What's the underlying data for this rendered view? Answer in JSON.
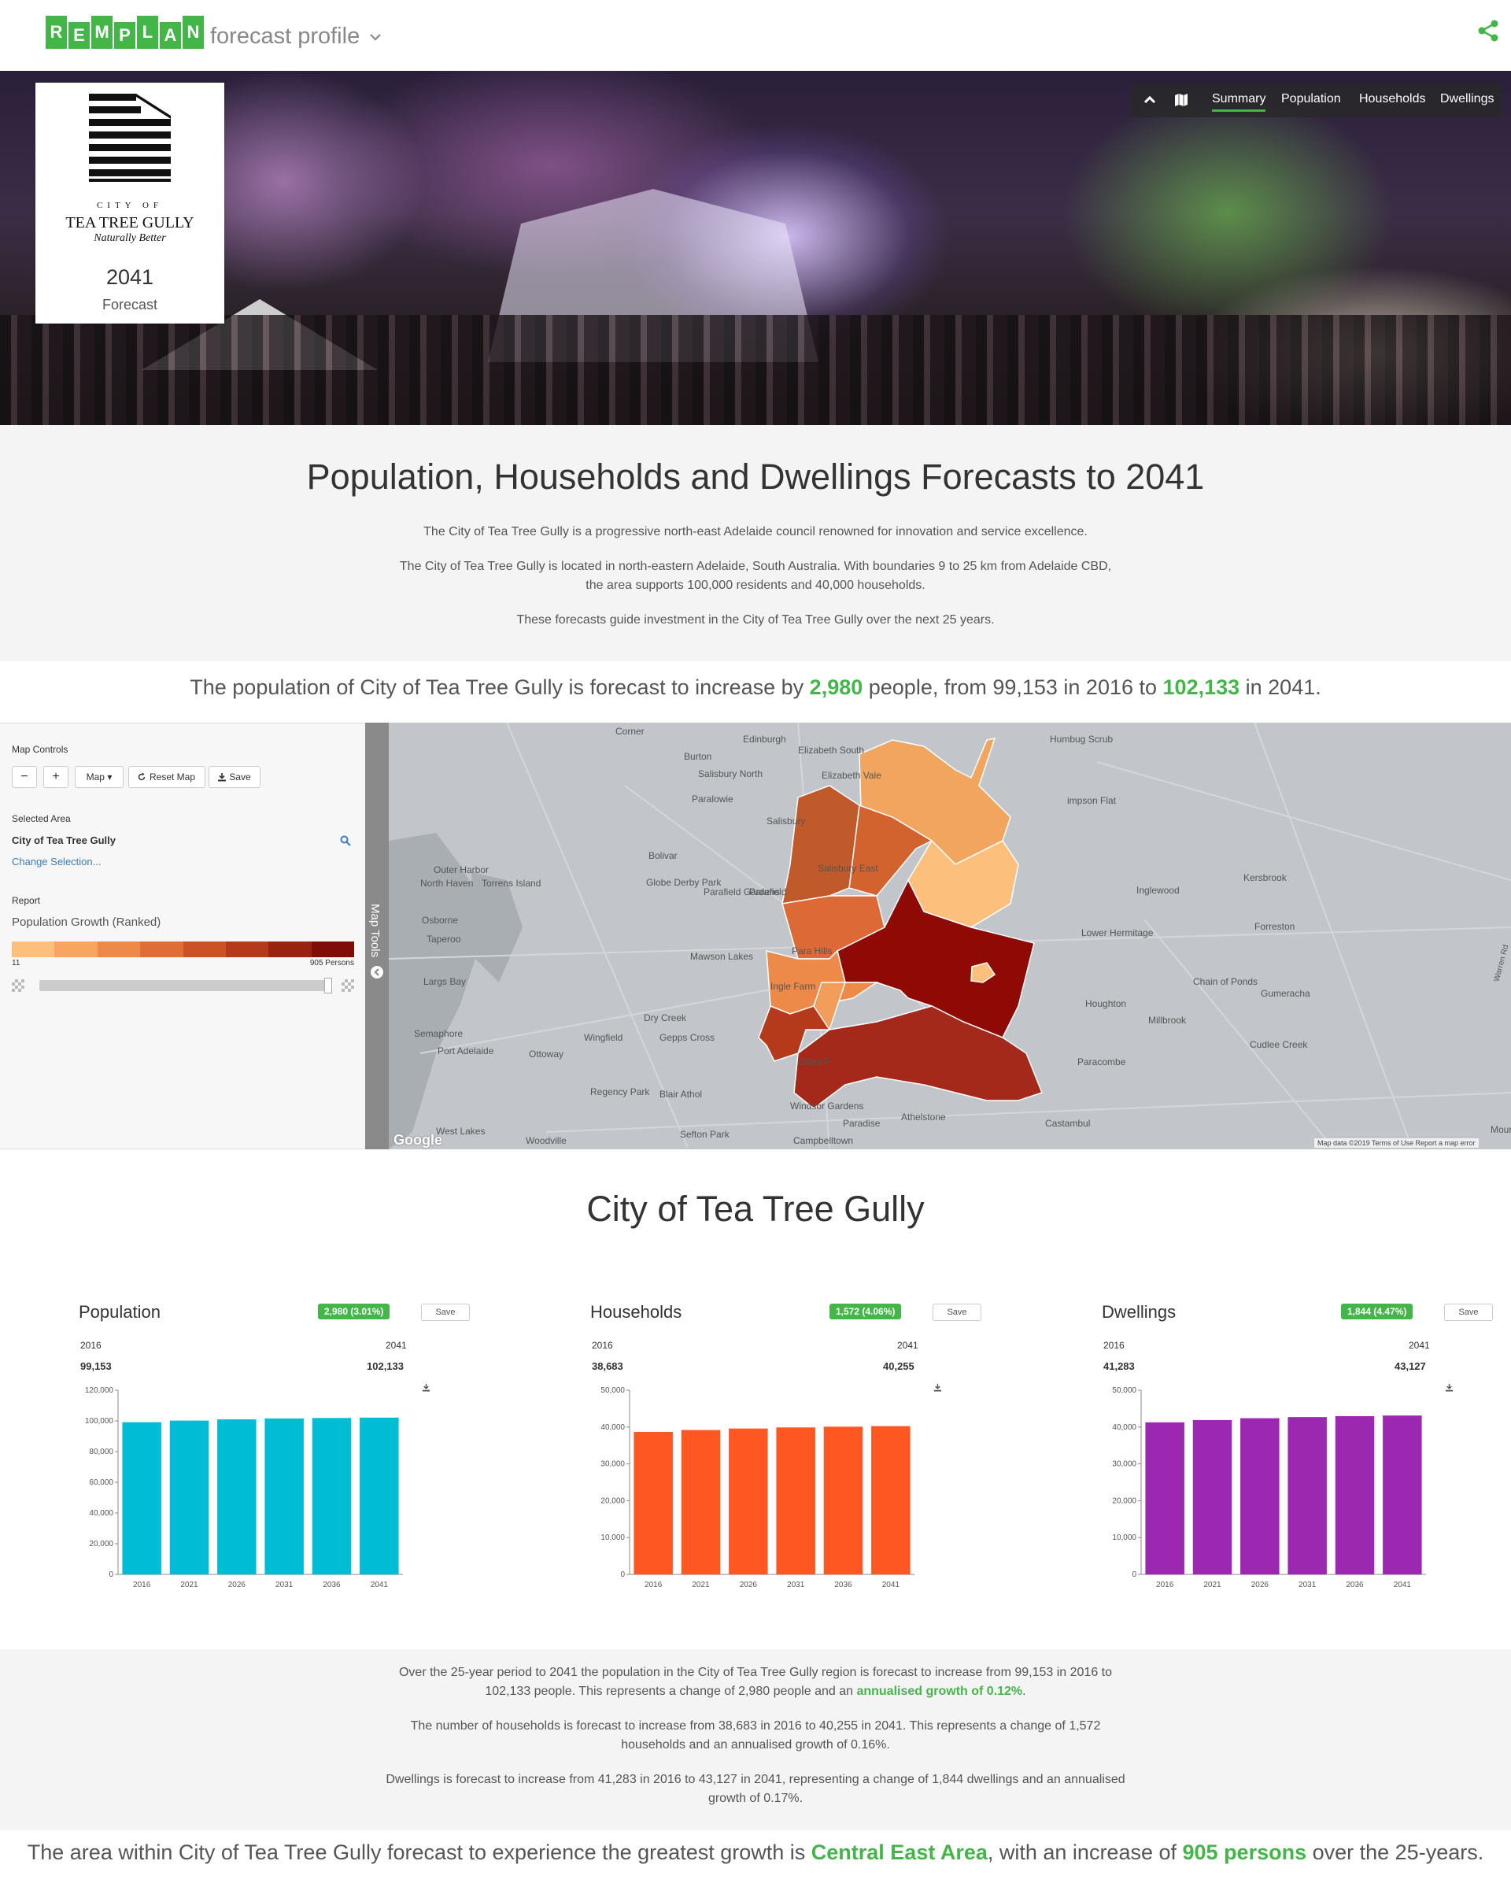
{
  "brand": {
    "logo_letters": [
      "R",
      "E",
      "M",
      "P",
      "L",
      "A",
      "N"
    ],
    "product": "forecast profile"
  },
  "council": {
    "city_of": "CITY OF",
    "name": "TEA TREE GULLY",
    "tagline": "Naturally Better",
    "year": "2041",
    "subtitle": "Forecast"
  },
  "nav": {
    "links": [
      "Summary",
      "Population",
      "Households",
      "Dwellings"
    ],
    "active": "Summary"
  },
  "intro": {
    "title": "Population, Households and Dwellings Forecasts to 2041",
    "p1": "The City of Tea Tree Gully is a progressive north-east Adelaide council renowned for innovation and service excellence.",
    "p2": "The City of Tea Tree Gully is located in north-eastern Adelaide, South Australia. With boundaries 9 to 25 km from Adelaide CBD, the area supports 100,000 residents and 40,000 households.",
    "p3": "These forecasts guide investment in the City of Tea Tree Gully over the next 25 years."
  },
  "headline": {
    "pre": "The population of City of Tea Tree Gully is forecast to increase by ",
    "change": "2,980",
    "mid": " people, from 99,153 in 2016 to ",
    "end_value": "102,133",
    "post": " in 2041."
  },
  "map_controls": {
    "title": "Map Controls",
    "zoom_out": "−",
    "zoom_in": "+",
    "map_button": "Map ▾",
    "reset_button": "Reset Map",
    "save_button": "Save",
    "selected_area_label": "Selected Area",
    "selected_area": "City of Tea Tree Gully",
    "change_selection": "Change Selection...",
    "report_label": "Report",
    "report_name": "Population Growth (Ranked)",
    "legend_min": "11",
    "legend_max": "905 Persons",
    "legend_colors": [
      "#fdbf7c",
      "#f7a560",
      "#ee8a49",
      "#e06c36",
      "#cc5226",
      "#b5391b",
      "#9a2210",
      "#7f0c06"
    ],
    "map_tools": "Map Tools"
  },
  "map": {
    "attribution": "Map data ©2019   Terms of Use   Report a map error",
    "google": "Google",
    "places": [
      "Corner",
      "Edinburgh",
      "Burton",
      "Elizabeth South",
      "Elizabeth Vale",
      "Salisbury North",
      "Paralowie",
      "Salisbury",
      "Humbug Scrub",
      "impson Flat",
      "Bolivar",
      "Salisbury East",
      "Outer Harbor",
      "North Haven",
      "Torrens Island",
      "Globe Derby Park",
      "Parafield Gardens",
      "Parafield",
      "Inglewood",
      "Kersbrook",
      "Osborne",
      "Taperoo",
      "Lower Hermitage",
      "Forreston",
      "Mawson Lakes",
      "Para Hills",
      "Largs Bay",
      "Ingle Farm",
      "Chain of Ponds",
      "Gumeracha",
      "Houghton",
      "Dry Creek",
      "Millbrook",
      "Semaphore",
      "Wingfield",
      "Gepps Cross",
      "Port Adelaide",
      "Ottoway",
      "Cudlee Creek",
      "Gilles P",
      "Paracombe",
      "Regency Park",
      "Blair Athol",
      "Windsor Gardens",
      "Paradise",
      "Athelstone",
      "Castambul",
      "West Lakes",
      "Woodville",
      "Sefton Park",
      "Campbelltown",
      "Mount",
      "Warren Rd"
    ]
  },
  "section_title": "City of Tea Tree Gully",
  "charts_meta": [
    {
      "title": "Population",
      "badge": "2,980 (3.01%)",
      "save": "Save",
      "start_year": "2016",
      "end_year": "2041",
      "start_value": "99,153",
      "end_value": "102,133"
    },
    {
      "title": "Households",
      "badge": "1,572 (4.06%)",
      "save": "Save",
      "start_year": "2016",
      "end_year": "2041",
      "start_value": "38,683",
      "end_value": "40,255"
    },
    {
      "title": "Dwellings",
      "badge": "1,844 (4.47%)",
      "save": "Save",
      "start_year": "2016",
      "end_year": "2041",
      "start_value": "41,283",
      "end_value": "43,127"
    }
  ],
  "chart_data": [
    {
      "type": "bar",
      "title": "Population",
      "categories": [
        "2016",
        "2021",
        "2026",
        "2031",
        "2036",
        "2041"
      ],
      "values": [
        99153,
        100200,
        101000,
        101600,
        101900,
        102133
      ],
      "ylim": [
        0,
        120000
      ],
      "yticks": [
        "0",
        "20,000",
        "40,000",
        "60,000",
        "80,000",
        "100,000",
        "120,000"
      ],
      "color": "#00bcd4"
    },
    {
      "type": "bar",
      "title": "Households",
      "categories": [
        "2016",
        "2021",
        "2026",
        "2031",
        "2036",
        "2041"
      ],
      "values": [
        38683,
        39200,
        39600,
        39900,
        40100,
        40255
      ],
      "ylim": [
        0,
        50000
      ],
      "yticks": [
        "0",
        "10,000",
        "20,000",
        "30,000",
        "40,000",
        "50,000"
      ],
      "color": "#ff5722"
    },
    {
      "type": "bar",
      "title": "Dwellings",
      "categories": [
        "2016",
        "2021",
        "2026",
        "2031",
        "2036",
        "2041"
      ],
      "values": [
        41283,
        41900,
        42400,
        42700,
        42950,
        43127
      ],
      "ylim": [
        0,
        50000
      ],
      "yticks": [
        "0",
        "10,000",
        "20,000",
        "30,000",
        "40,000",
        "50,000"
      ],
      "color": "#9c27b0"
    }
  ],
  "summary": {
    "p1_pre": "Over the 25-year period to 2041 the population in the City of Tea Tree Gully region is forecast to increase from 99,153 in 2016 to 102,133 people. This represents a change of 2,980 people and an ",
    "p1_green": "annualised growth of 0.12%",
    "p1_post": ".",
    "p2": "The number of households is forecast to increase from 38,683 in 2016 to 40,255 in 2041. This represents a change of 1,572 households and an annualised growth of 0.16%.",
    "p3": "Dwellings is forecast to increase from 41,283 in 2016 to 43,127 in 2041, representing a change of 1,844 dwellings and an annualised growth of 0.17%."
  },
  "footer": {
    "pre": "The area within City of Tea Tree Gully forecast to experience the greatest growth is ",
    "area": "Central East Area",
    "mid": ", with an increase of ",
    "amount": "905 persons",
    "post": " over the 25-years."
  },
  "colors": {
    "brand_green": "#44b649"
  }
}
